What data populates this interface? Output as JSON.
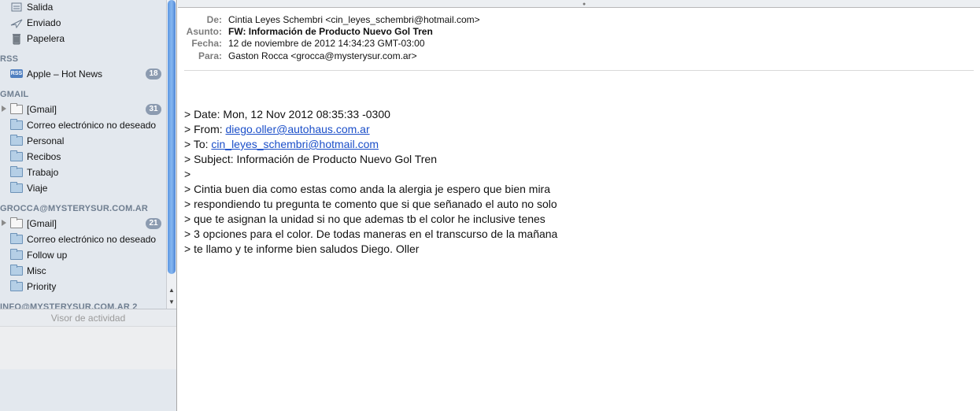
{
  "sidebar": {
    "mailboxes": [
      {
        "label": "Salida",
        "icon": "outbox-icon"
      },
      {
        "label": "Enviado",
        "icon": "sent-icon"
      },
      {
        "label": "Papelera",
        "icon": "trash-icon"
      }
    ],
    "rss": {
      "title": "RSS",
      "items": [
        {
          "label": "Apple – Hot News",
          "badge": "18",
          "icon": "rss-icon"
        }
      ]
    },
    "gmail": {
      "title": "GMAIL",
      "items": [
        {
          "label": "[Gmail]",
          "badge": "31"
        },
        {
          "label": "Correo electrónico no deseado"
        },
        {
          "label": "Personal"
        },
        {
          "label": "Recibos"
        },
        {
          "label": "Trabajo"
        },
        {
          "label": "Viaje"
        }
      ]
    },
    "grocca": {
      "title": "GROCCA@MYSTERYSUR.COM.AR",
      "items": [
        {
          "label": "[Gmail]",
          "badge": "21"
        },
        {
          "label": "Correo electrónico no deseado"
        },
        {
          "label": "Follow up"
        },
        {
          "label": "Misc"
        },
        {
          "label": "Priority"
        }
      ]
    },
    "info_title": "INFO@MYSTERYSUR.COM.AR 2",
    "activity_title": "Visor de actividad"
  },
  "message": {
    "headers": {
      "from_label": "De:",
      "from_value": "Cintia Leyes Schembri <cin_leyes_schembri@hotmail.com>",
      "subject_label": "Asunto:",
      "subject_value": "FW: Información de Producto Nuevo Gol Tren",
      "date_label": "Fecha:",
      "date_value": "12 de noviembre de 2012 14:34:23 GMT-03:00",
      "to_label": "Para:",
      "to_value": "Gaston Rocca <grocca@mysterysur.com.ar>"
    },
    "body": {
      "date_line": "> Date: Mon, 12 Nov 2012 08:35:33 -0300",
      "from_prefix": "> From: ",
      "from_link": "diego.oller@autohaus.com.ar",
      "to_prefix": "> To: ",
      "to_link": "cin_leyes_schembri@hotmail.com",
      "subject_line": "> Subject: Información de Producto Nuevo Gol Tren",
      "blank_quote": ">",
      "lines": [
        "> Cintia buen dia como estas como anda la alergia je espero que bien mira",
        "> respondiendo tu pregunta te comento que si que señanado el auto no solo",
        "> que te asignan la unidad si no que ademas tb el color he inclusive tenes",
        "> 3 opciones para el color. De todas maneras en el transcurso de la mañana",
        "> te llamo y te informe bien saludos Diego. Oller"
      ]
    }
  }
}
